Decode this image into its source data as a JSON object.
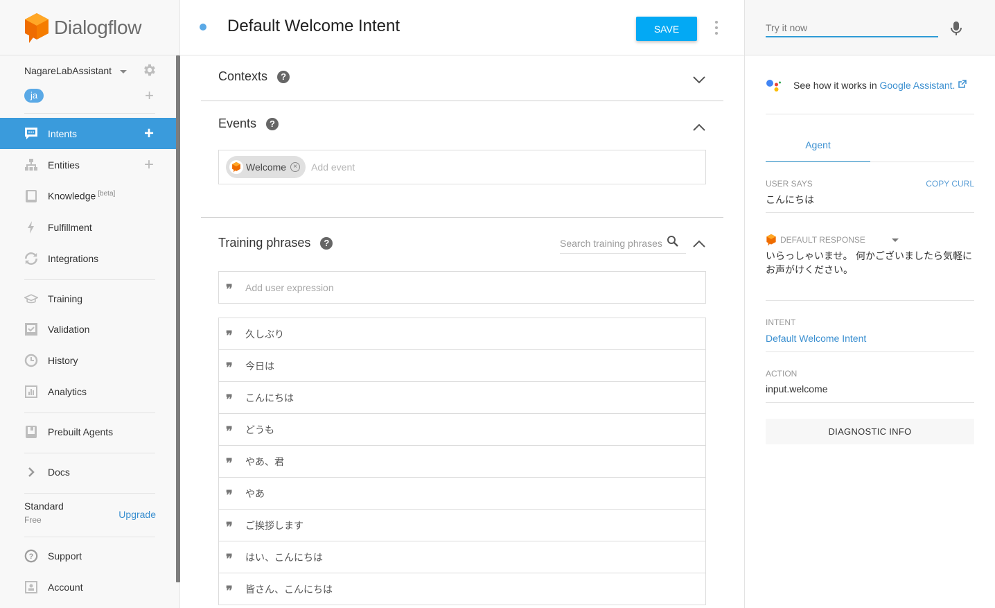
{
  "app": {
    "brand": "Dialogflow",
    "brand_color": "#f57c00",
    "accent_color": "#3a9bdc"
  },
  "sidebar": {
    "agent_name": "NagareLabAssistant",
    "language_badge": "ja",
    "nav_groups": [
      [
        {
          "label": "Intents",
          "icon": "intents-icon",
          "active": true,
          "has_add": true
        },
        {
          "label": "Entities",
          "icon": "entities-icon",
          "active": false,
          "has_add": true
        },
        {
          "label": "Knowledge",
          "badge": "[beta]",
          "icon": "knowledge-icon",
          "active": false
        },
        {
          "label": "Fulfillment",
          "icon": "fulfillment-icon",
          "active": false
        },
        {
          "label": "Integrations",
          "icon": "integrations-icon",
          "active": false
        }
      ],
      [
        {
          "label": "Training",
          "icon": "training-icon"
        },
        {
          "label": "Validation",
          "icon": "validation-icon"
        },
        {
          "label": "History",
          "icon": "history-icon"
        },
        {
          "label": "Analytics",
          "icon": "analytics-icon"
        }
      ],
      [
        {
          "label": "Prebuilt Agents",
          "icon": "prebuilt-agents-icon"
        }
      ],
      [
        {
          "label": "Docs",
          "icon": "chevron-right-icon"
        }
      ]
    ],
    "plan": {
      "name": "Standard",
      "tier": "Free",
      "upgrade_label": "Upgrade"
    },
    "bottom": [
      {
        "label": "Support",
        "icon": "support-icon"
      },
      {
        "label": "Account",
        "icon": "account-icon"
      }
    ]
  },
  "main": {
    "intent_title": "Default Welcome Intent",
    "save_label": "SAVE",
    "sections": {
      "contexts": {
        "title": "Contexts",
        "expanded": false
      },
      "events": {
        "title": "Events",
        "expanded": true,
        "chips": [
          "Welcome"
        ],
        "add_placeholder": "Add event"
      },
      "training_phrases": {
        "title": "Training phrases",
        "expanded": true,
        "search_placeholder": "Search training phrases",
        "add_placeholder": "Add user expression",
        "phrases": [
          "久しぶり",
          "今日は",
          "こんにちは",
          "どうも",
          "やあ、君",
          "やあ",
          "ご挨拶します",
          "はい、こんにちは",
          "皆さん、こんにちは"
        ]
      }
    }
  },
  "right_panel": {
    "try_placeholder": "Try it now",
    "google_assistant": {
      "prefix": "See how it works in ",
      "link": "Google Assistant."
    },
    "tab": "Agent",
    "user_says_label": "USER SAYS",
    "copy_curl_label": "COPY CURL",
    "user_says_value": "こんにちは",
    "default_response_label": "DEFAULT RESPONSE",
    "default_response_text": "いらっしゃいませ。 何かございましたら気軽にお声がけください。",
    "intent_label": "INTENT",
    "intent_value": "Default Welcome Intent",
    "action_label": "ACTION",
    "action_value": "input.welcome",
    "diagnostic_label": "DIAGNOSTIC INFO"
  }
}
